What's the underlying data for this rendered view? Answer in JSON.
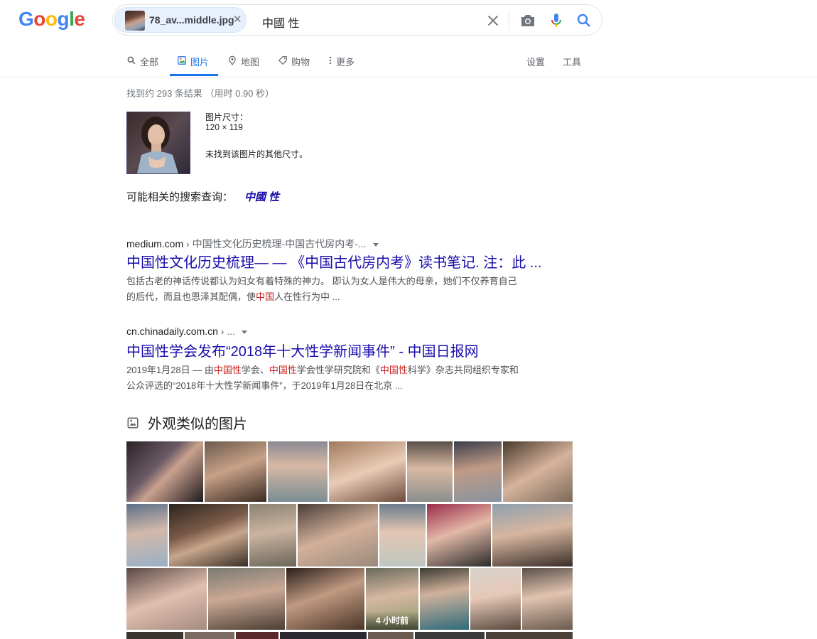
{
  "logo": {
    "letters": [
      "G",
      "o",
      "o",
      "g",
      "l",
      "e"
    ],
    "colors": [
      "#4285f4",
      "#ea4335",
      "#fbbc05",
      "#4285f4",
      "#34a853",
      "#ea4335"
    ]
  },
  "search": {
    "chip_filename": "78_av...middle.jpg",
    "chip_remove_icon": "close-icon",
    "query": "中國 性",
    "icons": [
      "close-icon",
      "camera-icon",
      "mic-icon",
      "search-icon"
    ]
  },
  "tabs": {
    "all": "全部",
    "images": "图片",
    "maps": "地图",
    "shopping": "购物",
    "more": "更多",
    "settings": "设置",
    "tools": "工具",
    "active": "images"
  },
  "stats": "找到约 293 条结果 （用时 0.90 秒）",
  "query_image": {
    "size_label": "图片尺寸：",
    "size_value": "120 × 119",
    "no_other_sizes": "未找到该图片的其他尺寸。"
  },
  "best_guess": {
    "label": "可能相关的搜索查询：",
    "link": "中國 性"
  },
  "results": [
    {
      "domain": "medium.com",
      "path": " › 中国性文化历史梳理-中国古代房内考-...",
      "title": "中国性文化历史梳理— — 《中国古代房内考》读书笔记. 注：此 ...",
      "snippet_line1": "包括古老的神话传说都认为妇女有着特殊的神力。 即认为女人是伟大的母亲，她们不仅养育自己",
      "snippet_line2_pre": "的后代，而且也恩泽其配偶，使",
      "snippet_line2_hl": "中国",
      "snippet_line2_post": "人在性行为中 ..."
    },
    {
      "domain": "cn.chinadaily.com.cn",
      "path": " › ...",
      "title": "中国性学会发布“2018年十大性学新闻事件” - 中国日报网",
      "snippet_date": "2019年1月28日 — 由",
      "snippet_hl1": "中国性",
      "snippet_t1": "学会、",
      "snippet_hl2": "中国性",
      "snippet_t2": "学会性学研究院和《",
      "snippet_hl3": "中国性",
      "snippet_t3": "科学》杂志共同组织专家和",
      "snippet_line2": "公众评选的“2018年十大性学新闻事件”，于2019年1月28日在北京 ..."
    }
  ],
  "similar": {
    "heading": "外观类似的图片",
    "heading_icon": "image-icon",
    "badge": "4 小时前"
  }
}
